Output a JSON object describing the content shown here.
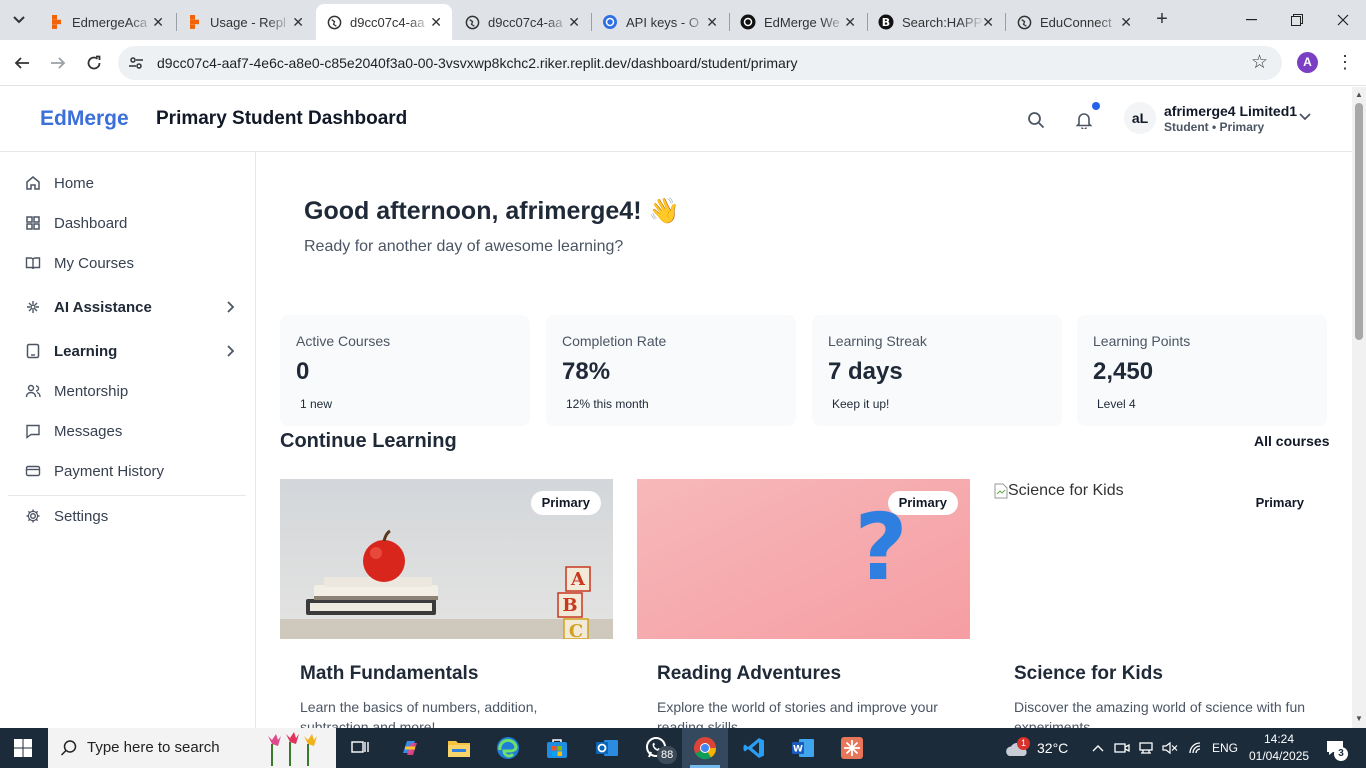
{
  "browser": {
    "tabs": [
      {
        "label": "EdmergeAca",
        "favicon": "replit-icon"
      },
      {
        "label": "Usage - Repl",
        "favicon": "replit-icon"
      },
      {
        "label": "d9cc07c4-aa",
        "favicon": "globe-icon",
        "active": true
      },
      {
        "label": "d9cc07c4-aa",
        "favicon": "globe-icon"
      },
      {
        "label": "API keys - O",
        "favicon": "openai-icon"
      },
      {
        "label": "EdMerge We",
        "favicon": "openai-icon"
      },
      {
        "label": "Search:HAPP",
        "favicon": "b-icon"
      },
      {
        "label": "EduConnect",
        "favicon": "globe-icon"
      }
    ],
    "url": "d9cc07c4-aaf7-4e6c-a8e0-c85e2040f3a0-00-3vsvxwp8kchc2.riker.replit.dev/dashboard/student/primary",
    "profile_initial": "A"
  },
  "app": {
    "brand": "EdMerge",
    "page_title": "Primary Student Dashboard",
    "user": {
      "initials": "aL",
      "name": "afrimerge4 Limited1",
      "role": "Student • Primary"
    }
  },
  "sidebar": {
    "items": [
      {
        "label": "Home",
        "icon": "home-icon"
      },
      {
        "label": "Dashboard",
        "icon": "dashboard-icon"
      },
      {
        "label": "My Courses",
        "icon": "book-icon"
      },
      {
        "label": "AI Assistance",
        "icon": "brain-icon",
        "expandable": true
      },
      {
        "label": "Learning",
        "icon": "tablet-icon",
        "expandable": true
      },
      {
        "label": "Mentorship",
        "icon": "users-icon"
      },
      {
        "label": "Messages",
        "icon": "message-icon"
      },
      {
        "label": "Payment History",
        "icon": "credit-card-icon"
      },
      {
        "label": "Settings",
        "icon": "gear-icon"
      }
    ]
  },
  "main": {
    "greeting": "Good afternoon, afrimerge4! 👋",
    "greeting_sub": "Ready for another day of awesome learning?",
    "stats": [
      {
        "label": "Active Courses",
        "value": "0",
        "sub": "1 new"
      },
      {
        "label": "Completion Rate",
        "value": "78%",
        "sub": "12% this month"
      },
      {
        "label": "Learning Streak",
        "value": "7 days",
        "sub": "Keep it up!"
      },
      {
        "label": "Learning Points",
        "value": "2,450",
        "sub": "Level 4"
      }
    ],
    "continue_title": "Continue Learning",
    "all_courses": "All courses",
    "courses": [
      {
        "title": "Math Fundamentals",
        "badge": "Primary",
        "description": "Learn the basics of numbers, addition, subtraction and more!"
      },
      {
        "title": "Reading Adventures",
        "badge": "Primary",
        "description": "Explore the world of stories and improve your reading skills"
      },
      {
        "title": "Science for Kids",
        "badge": "Primary",
        "description": "Discover the amazing world of science with fun experiments",
        "image_alt": "Science for Kids"
      }
    ]
  },
  "taskbar": {
    "search_placeholder": "Type here to search",
    "whatsapp_badge": "88",
    "weather_alert": "1",
    "temperature": "32°C",
    "language": "ENG",
    "time": "14:24",
    "date": "01/04/2025",
    "notifications_count": "3"
  },
  "colors": {
    "brand": "#3b6fd9",
    "notification_dot": "#2563eb",
    "taskbar": "#1c2b3a"
  }
}
